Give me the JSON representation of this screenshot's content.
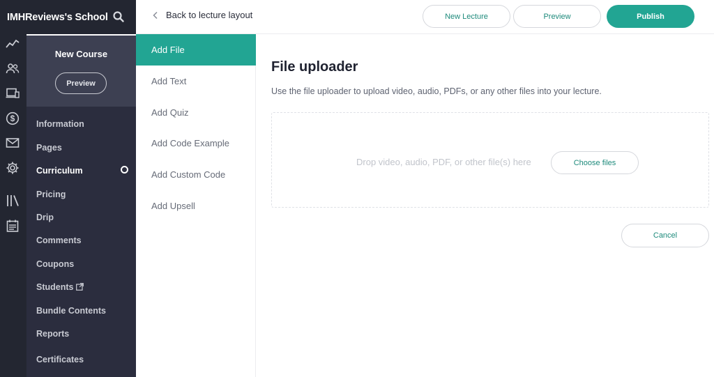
{
  "school": {
    "name": "IMHReviews's School"
  },
  "course": {
    "title": "New Course",
    "preview_label": "Preview",
    "nav": [
      {
        "label": "Information"
      },
      {
        "label": "Pages"
      },
      {
        "label": "Curriculum",
        "active": true
      },
      {
        "label": "Pricing"
      },
      {
        "label": "Drip"
      },
      {
        "label": "Comments"
      },
      {
        "label": "Coupons"
      },
      {
        "label": "Students",
        "external": true
      },
      {
        "label": "Bundle Contents"
      },
      {
        "label": "Reports"
      },
      {
        "label": "Certificates"
      }
    ]
  },
  "rail_icons": [
    "trend-chart-icon",
    "users-icon",
    "devices-icon",
    "dollar-icon",
    "mail-icon",
    "gear-icon",
    "library-icon",
    "calendar-icon"
  ],
  "topbar": {
    "back_label": "Back to lecture layout",
    "new_lecture_label": "New Lecture",
    "preview_label": "Preview",
    "publish_label": "Publish"
  },
  "content_menu": {
    "items": [
      {
        "label": "Add File",
        "active": true
      },
      {
        "label": "Add Text"
      },
      {
        "label": "Add Quiz"
      },
      {
        "label": "Add Code Example"
      },
      {
        "label": "Add Custom Code"
      },
      {
        "label": "Add Upsell"
      }
    ]
  },
  "uploader": {
    "title": "File uploader",
    "description": "Use the file uploader to upload video, audio, PDFs, or any other files into your lecture.",
    "drop_text": "Drop video, audio, PDF, or other file(s) here",
    "choose_label": "Choose files",
    "cancel_label": "Cancel"
  },
  "colors": {
    "accent": "#22a593",
    "rail_bg": "#232631",
    "nav_bg": "#2b2d3e",
    "course_head_bg": "#3d4052"
  }
}
